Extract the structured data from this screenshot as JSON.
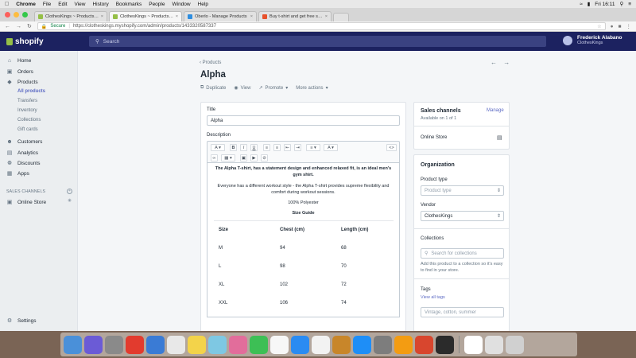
{
  "menubar": {
    "apple": "",
    "items": [
      "Chrome",
      "File",
      "Edit",
      "View",
      "History",
      "Bookmarks",
      "People",
      "Window",
      "Help"
    ],
    "clock": "Fri 16:11"
  },
  "tabs": [
    {
      "title": "ClothesKings ~ Products ~ Sh",
      "color": "#95bf47",
      "active": false
    },
    {
      "title": "ClothesKings ~ Products ~ Al",
      "color": "#95bf47",
      "active": true
    },
    {
      "title": "Oberlo - Manage Products",
      "color": "#2f8ee0",
      "active": false
    },
    {
      "title": "Buy t-shirt and get free shipp",
      "color": "#e8512b",
      "active": false
    }
  ],
  "address": {
    "secure_label": "Secure",
    "url": "https://clotheskings.myshopify.com/admin/products/1433320587337"
  },
  "topbar": {
    "logo": "shopify",
    "search_placeholder": "Search",
    "user_name": "Frederick Alabano",
    "store_name": "ClothesKings"
  },
  "sidebar": {
    "items": [
      "Home",
      "Orders",
      "Products"
    ],
    "subitems": [
      "All products",
      "Transfers",
      "Inventory",
      "Collections",
      "Gift cards"
    ],
    "items2": [
      "Customers",
      "Analytics",
      "Discounts",
      "Apps"
    ],
    "channels_header": "SALES CHANNELS",
    "online_store": "Online Store",
    "settings": "Settings"
  },
  "page": {
    "breadcrumb": "Products",
    "title": "Alpha",
    "actions": [
      "Duplicate",
      "View",
      "Promote",
      "More actions"
    ]
  },
  "form": {
    "title_label": "Title",
    "title_value": "Alpha",
    "description_label": "Description",
    "desc_bold": "The Alpha T-shirt, has a statement design and enhanced relaxed fit, is an ideal men's gym shirt.",
    "desc_para": "Everyone has a different workout style - the Alpha T-shirt provides supreme flexibility and comfort during workout sessions.",
    "desc_material": "100% Polyester",
    "size_guide": "Size Guide",
    "table": {
      "headers": [
        "Size",
        "Chest (cm)",
        "Length (cm)"
      ],
      "rows": [
        [
          "M",
          "94",
          "68"
        ],
        [
          "L",
          "98",
          "70"
        ],
        [
          "XL",
          "102",
          "72"
        ],
        [
          "XXL",
          "106",
          "74"
        ]
      ]
    }
  },
  "right": {
    "sales_title": "Sales channels",
    "manage": "Manage",
    "available": "Available on 1 of 1",
    "online_store": "Online Store",
    "org_title": "Organization",
    "product_type_label": "Product type",
    "product_type_placeholder": "Product type",
    "vendor_label": "Vendor",
    "vendor_value": "ClothesKings",
    "collections_label": "Collections",
    "collections_placeholder": "Search for collections",
    "collections_help": "Add this product to a collection so it's easy to find in your store.",
    "tags_label": "Tags",
    "view_all_tags": "View all tags",
    "tags_placeholder": "Vintage, cotton, summer"
  },
  "dock": {
    "colors": [
      "#4a90d9",
      "#6b5bd6",
      "#8a8a8a",
      "#e23b2e",
      "#3a7bd5",
      "#e8e8e8",
      "#f3d34a",
      "#7ec8e3",
      "#e26d9b",
      "#3dbf55",
      "#f7f7f7",
      "#2a8bf2",
      "#f2f2f2",
      "#c8862a",
      "#1e8ef7",
      "#7d7d7d",
      "#f39c12",
      "#d8462e",
      "#2b2b2b",
      "#ffffff",
      "#e0e0e0",
      "#d0d0d0"
    ]
  }
}
